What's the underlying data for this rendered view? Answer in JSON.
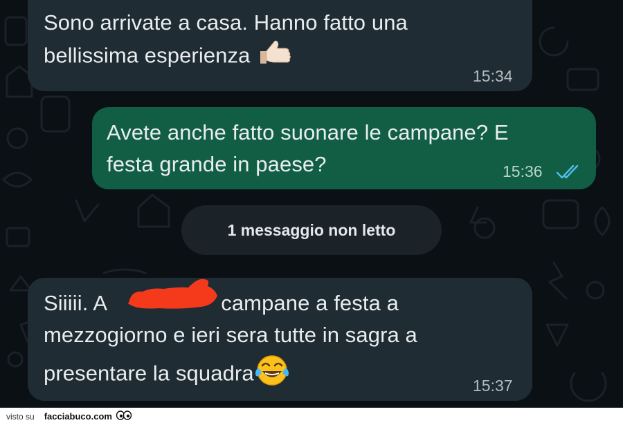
{
  "messages": [
    {
      "direction": "incoming",
      "lines": [
        "Sono arrivate a casa. Hanno fatto una",
        "bellissima esperienza"
      ],
      "emoji": "thumbs-up",
      "time": "15:34"
    },
    {
      "direction": "outgoing",
      "lines": [
        "Avete anche fatto suonare le campane? E",
        "festa grande in paese?"
      ],
      "time": "15:36",
      "status": "read"
    },
    {
      "direction": "incoming",
      "lines": [
        "Siiiii. A",
        "campane a festa a",
        "mezzogiorno e ieri sera tutte in sagra a",
        "presentare la squadra"
      ],
      "emoji": "face-with-tears-of-joy",
      "time": "15:37"
    }
  ],
  "unread_divider": {
    "label": "1 messaggio non letto"
  },
  "footer": {
    "prefix": "visto su",
    "site": "facciabuco.com"
  },
  "colors": {
    "background": "#0b1014",
    "incoming_bubble": "#1f2c33",
    "outgoing_bubble": "#115e45",
    "read_ticks": "#53bdeb",
    "redaction": "#f53a1c"
  }
}
